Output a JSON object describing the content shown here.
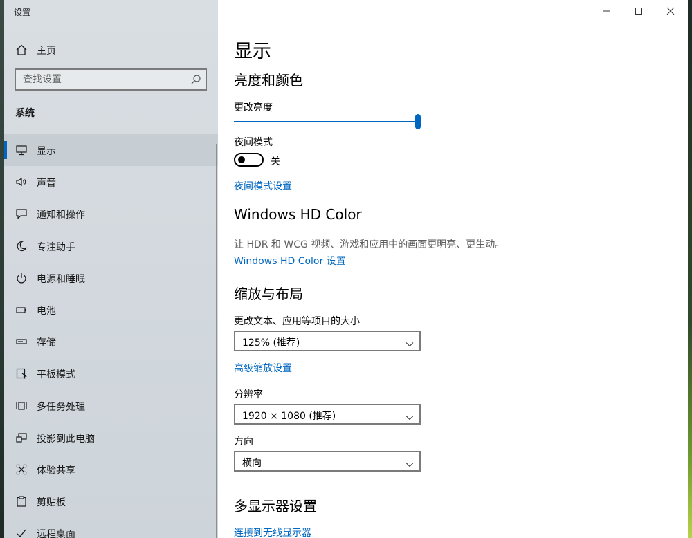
{
  "window": {
    "title": "设置"
  },
  "sidebar": {
    "home_label": "主页",
    "search_placeholder": "查找设置",
    "section_title": "系统",
    "items": [
      {
        "label": "显示",
        "icon": "monitor-icon",
        "active": true
      },
      {
        "label": "声音",
        "icon": "speaker-icon"
      },
      {
        "label": "通知和操作",
        "icon": "message-icon"
      },
      {
        "label": "专注助手",
        "icon": "moon-icon"
      },
      {
        "label": "电源和睡眠",
        "icon": "power-icon"
      },
      {
        "label": "电池",
        "icon": "battery-icon"
      },
      {
        "label": "存储",
        "icon": "storage-icon"
      },
      {
        "label": "平板模式",
        "icon": "tablet-icon"
      },
      {
        "label": "多任务处理",
        "icon": "multitask-icon"
      },
      {
        "label": "投影到此电脑",
        "icon": "project-icon"
      },
      {
        "label": "体验共享",
        "icon": "share-icon"
      },
      {
        "label": "剪贴板",
        "icon": "clipboard-icon"
      },
      {
        "label": "远程桌面",
        "icon": "remote-icon"
      }
    ]
  },
  "main": {
    "page_title": "显示",
    "brightness": {
      "heading": "亮度和颜色",
      "label": "更改亮度",
      "level_fraction": 1.0,
      "night_light_label": "夜间模式",
      "night_light_state": "关",
      "night_light_settings_link": "夜间模式设置"
    },
    "hdr": {
      "heading": "Windows HD Color",
      "description": "让 HDR 和 WCG 视频、游戏和应用中的画面更明亮、更生动。",
      "link": "Windows HD Color 设置"
    },
    "scale": {
      "heading": "缩放与布局",
      "scale_label": "更改文本、应用等项目的大小",
      "scale_value": "125% (推荐)",
      "advanced_link": "高级缩放设置",
      "resolution_label": "分辨率",
      "resolution_value": "1920 × 1080 (推荐)",
      "orientation_label": "方向",
      "orientation_value": "横向"
    },
    "multi": {
      "heading": "多显示器设置",
      "link": "连接到无线显示器"
    }
  },
  "colors": {
    "accent": "#0067c0",
    "sidebar_bg": "#d6dce1"
  }
}
